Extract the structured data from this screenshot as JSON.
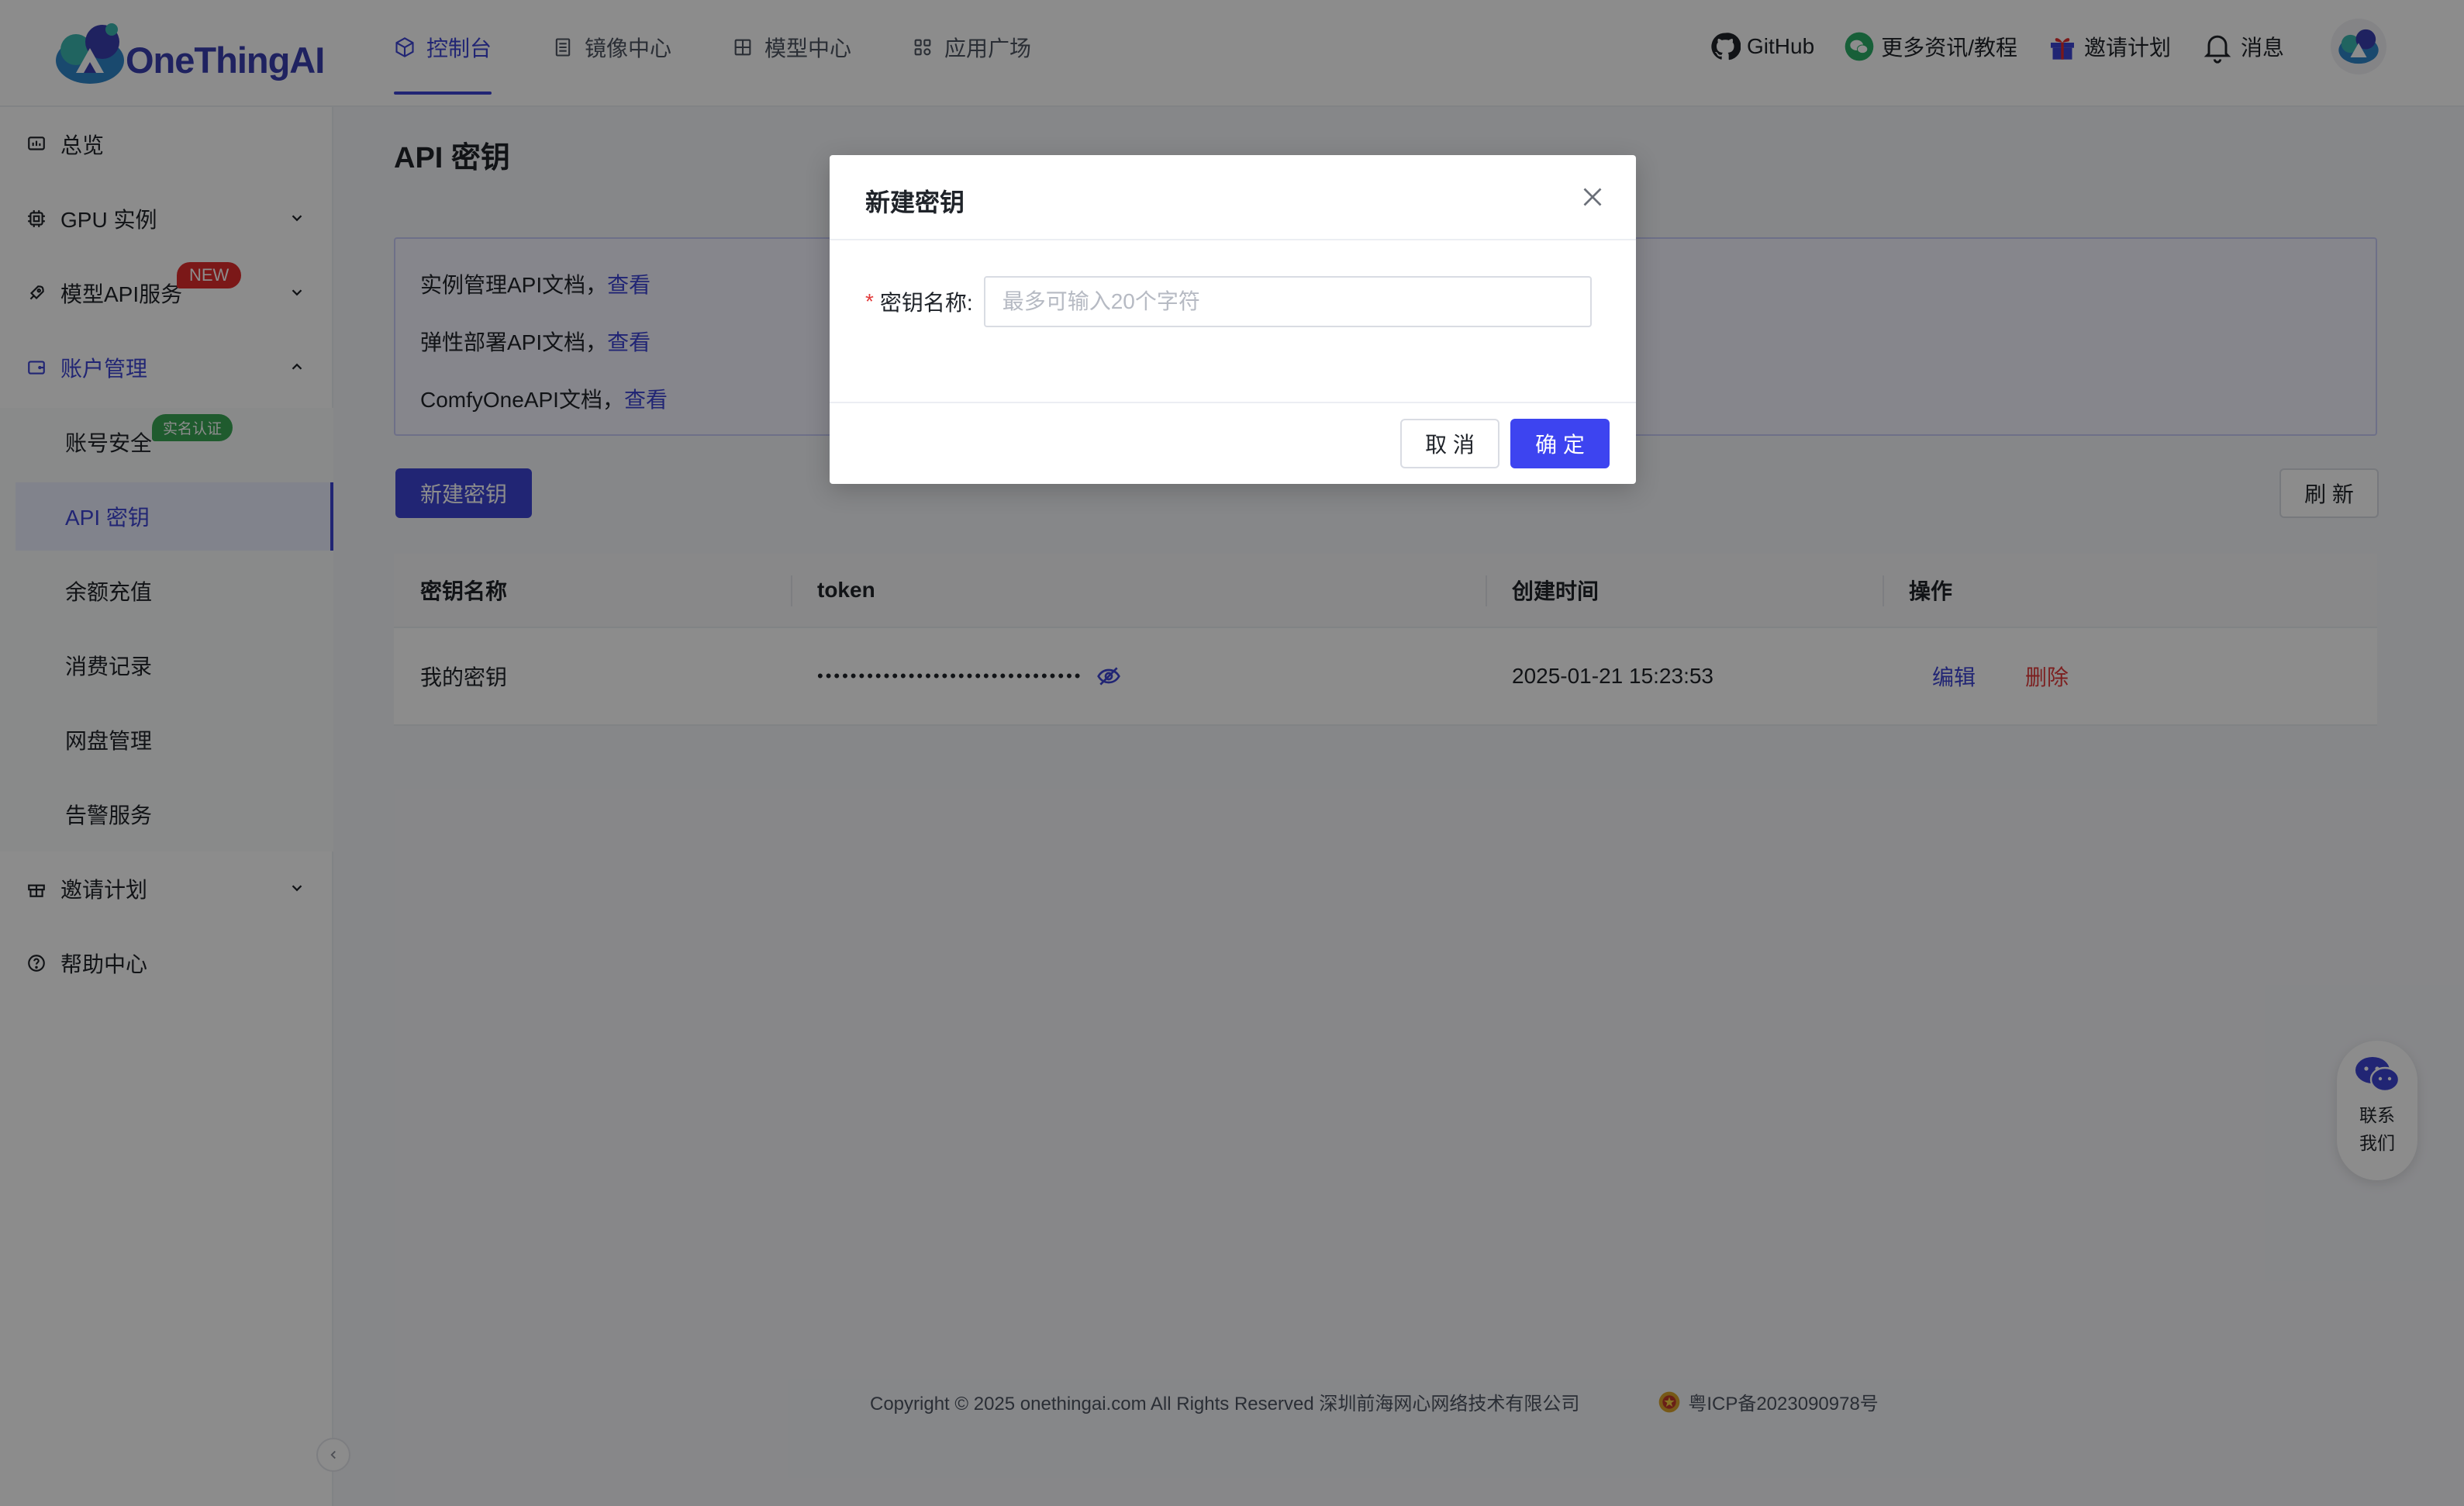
{
  "brand": {
    "name": "OneThingAI"
  },
  "topnav": {
    "tabs": [
      {
        "label": "控制台",
        "icon": "cube-icon"
      },
      {
        "label": "镜像中心",
        "icon": "document-icon"
      },
      {
        "label": "模型中心",
        "icon": "grid-icon"
      },
      {
        "label": "应用广场",
        "icon": "apps-icon"
      }
    ],
    "right": {
      "github": "GitHub",
      "news": "更多资讯/教程",
      "invite": "邀请计划",
      "messages": "消息"
    }
  },
  "sidebar": {
    "overview": "总览",
    "gpu": "GPU 实例",
    "model_api": "模型API服务",
    "new_badge": "NEW",
    "account": "账户管理",
    "sub": {
      "security": "账号安全",
      "verify_badge": "实名认证",
      "api_keys": "API 密钥",
      "recharge": "余额充值",
      "billing": "消费记录",
      "storage": "网盘管理",
      "alerts": "告警服务"
    },
    "invite": "邀请计划",
    "help": "帮助中心"
  },
  "main": {
    "title": "API 密钥",
    "docs": [
      {
        "text": "实例管理API文档，",
        "link": "查看"
      },
      {
        "text": "弹性部署API文档，",
        "link": "查看"
      },
      {
        "text": "ComfyOneAPI文档，",
        "link": "查看"
      }
    ],
    "new_key_button": "新建密钥",
    "refresh_button": "刷 新",
    "table": {
      "headers": [
        "密钥名称",
        "token",
        "创建时间",
        "操作"
      ],
      "rows": [
        {
          "name": "我的密钥",
          "token": "••••••••••••••••••••••••••••••••",
          "created": "2025-01-21 15:23:53",
          "edit": "编辑",
          "delete": "删除"
        }
      ]
    }
  },
  "footer": {
    "copyright": "Copyright © 2025 onethingai.com All Rights Reserved 深圳前海网心网络技术有限公司",
    "icp": "粤ICP备2023090978号"
  },
  "contact": {
    "line1": "联系",
    "line2": "我们"
  },
  "modal": {
    "title": "新建密钥",
    "required_mark": "*",
    "field_label": "密钥名称:",
    "field_placeholder": "最多可输入20个字符",
    "field_value": "",
    "cancel": "取 消",
    "ok": "确 定"
  },
  "colors": {
    "primary": "#3d44d4",
    "danger": "#e23b3b",
    "new_badge": "#e02d2d",
    "verify_badge": "#3aa655"
  }
}
